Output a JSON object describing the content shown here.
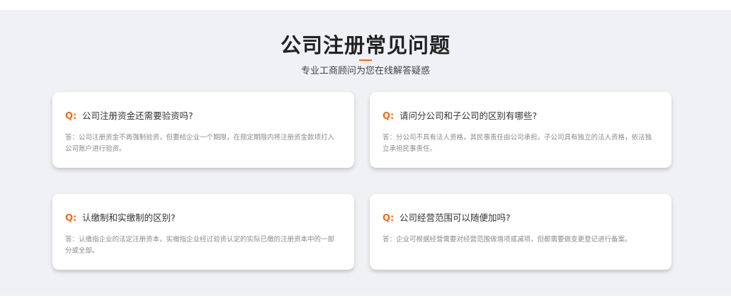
{
  "header": {
    "title": "公司注册常见问题",
    "subtitle": "专业工商顾问为您在线解答疑惑"
  },
  "colors": {
    "accent": "#f26b1d",
    "background": "#f0f1f5",
    "card": "#ffffff"
  },
  "faq": [
    {
      "q_marker": "Q:",
      "question": "公司注册资金还需要验资吗?",
      "answer": "答：公司注册资金不再强制验资，但要给企业一个期限，在规定期限内将注册资金款项打入公司账户进行验资。"
    },
    {
      "q_marker": "Q:",
      "question": "请问分公司和子公司的区别有哪些?",
      "answer": "答：分公司不具有法人资格，其民事责任由公司承担。子公司具有独立的法人资格，依法独立承担民事责任。"
    },
    {
      "q_marker": "Q:",
      "question": "认缴制和实缴制的区别?",
      "answer": "答：认缴指企业的法定注册资本，实缴指企业经过验资认定的实际已缴的注册资本中的一部分或全部。"
    },
    {
      "q_marker": "Q:",
      "question": "公司经营范围可以随便加吗?",
      "answer": "答：企业可根据经营需要对经营范围做增项或减项，但都需要做变更登记进行备案。"
    }
  ]
}
